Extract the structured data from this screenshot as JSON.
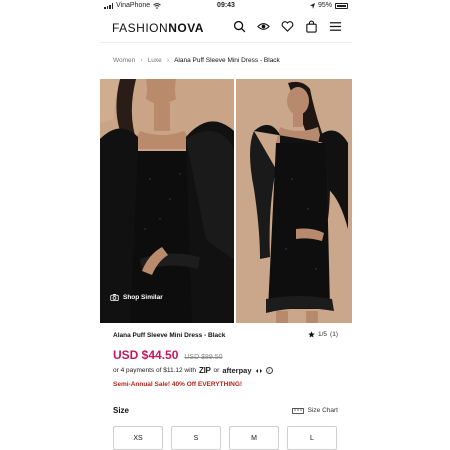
{
  "status_bar": {
    "carrier": "VinaPhone",
    "time": "09:43",
    "battery": "95%"
  },
  "header": {
    "logo_light": "FASHION",
    "logo_bold": "NOVA",
    "icons": [
      "search-icon",
      "eye-icon",
      "heart-icon",
      "shopping-bag-icon",
      "hamburger-menu-icon"
    ]
  },
  "breadcrumb": {
    "items": [
      "Women",
      "Luxe"
    ],
    "current": "Alana Puff Sleeve Mini Dress - Black",
    "separator": "›"
  },
  "gallery": {
    "shop_similar": "Shop Similar",
    "image_bg": "#c9a487"
  },
  "product": {
    "name": "Alana Puff Sleeve Mini Dress - Black",
    "image_counter": "1/5",
    "reviews": "(1)",
    "price_now": "USD $44.50",
    "price_was": "USD $89.50",
    "installments_prefix": "or 4 payments of $11.12 with",
    "zip_label": "ZIP",
    "or_label": "or",
    "afterpay_label": "afterpay",
    "promo": "Semi-Annual Sale! 40% Off EVERYTHING!"
  },
  "size_section": {
    "label": "Size",
    "size_chart": "Size Chart",
    "sizes": [
      "XS",
      "S",
      "M",
      "L"
    ]
  },
  "colors": {
    "price": "#c2185b",
    "promo": "#b3261e"
  }
}
